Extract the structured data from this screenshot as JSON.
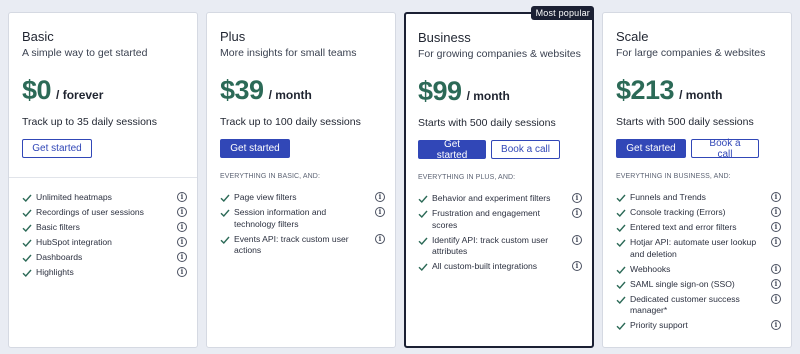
{
  "accent": "#3147b7",
  "price_color": "#2c6a57",
  "plans": [
    {
      "name": "Basic",
      "tagline": "A simple way to get started",
      "price": "$0",
      "period": "/ forever",
      "sessions": "Track up to 35 daily sessions",
      "buttons": [
        {
          "label": "Get started",
          "style": "outline"
        }
      ],
      "section_label": "",
      "features": [
        "Unlimited heatmaps",
        "Recordings of user sessions",
        "Basic filters",
        "HubSpot integration",
        "Dashboards",
        "Highlights"
      ]
    },
    {
      "name": "Plus",
      "tagline": "More insights for small teams",
      "price": "$39",
      "period": "/ month",
      "sessions": "Track up to 100 daily sessions",
      "buttons": [
        {
          "label": "Get started",
          "style": "solid"
        }
      ],
      "section_label": "EVERYTHING IN BASIC, AND:",
      "features": [
        "Page view filters",
        "Session information and technology filters",
        "Events API: track custom user actions"
      ]
    },
    {
      "name": "Business",
      "tagline": "For growing companies & websites",
      "badge": "Most popular",
      "price": "$99",
      "period": "/ month",
      "sessions": "Starts with 500 daily sessions",
      "buttons": [
        {
          "label": "Get started",
          "style": "solid"
        },
        {
          "label": "Book a call",
          "style": "outline"
        }
      ],
      "section_label": "EVERYTHING IN PLUS, AND:",
      "features": [
        "Behavior and experiment filters",
        "Frustration and engagement scores",
        "Identify API: track custom user attributes",
        "All custom-built integrations"
      ]
    },
    {
      "name": "Scale",
      "tagline": "For large companies & websites",
      "price": "$213",
      "period": "/ month",
      "sessions": "Starts with 500 daily sessions",
      "buttons": [
        {
          "label": "Get started",
          "style": "solid"
        },
        {
          "label": "Book a call",
          "style": "outline"
        }
      ],
      "section_label": "EVERYTHING IN BUSINESS, AND:",
      "features": [
        "Funnels and Trends",
        "Console tracking (Errors)",
        "Entered text and error filters",
        "Hotjar API: automate user lookup and deletion",
        "Webhooks",
        "SAML single sign-on (SSO)",
        "Dedicated customer success manager*",
        "Priority support"
      ]
    }
  ]
}
